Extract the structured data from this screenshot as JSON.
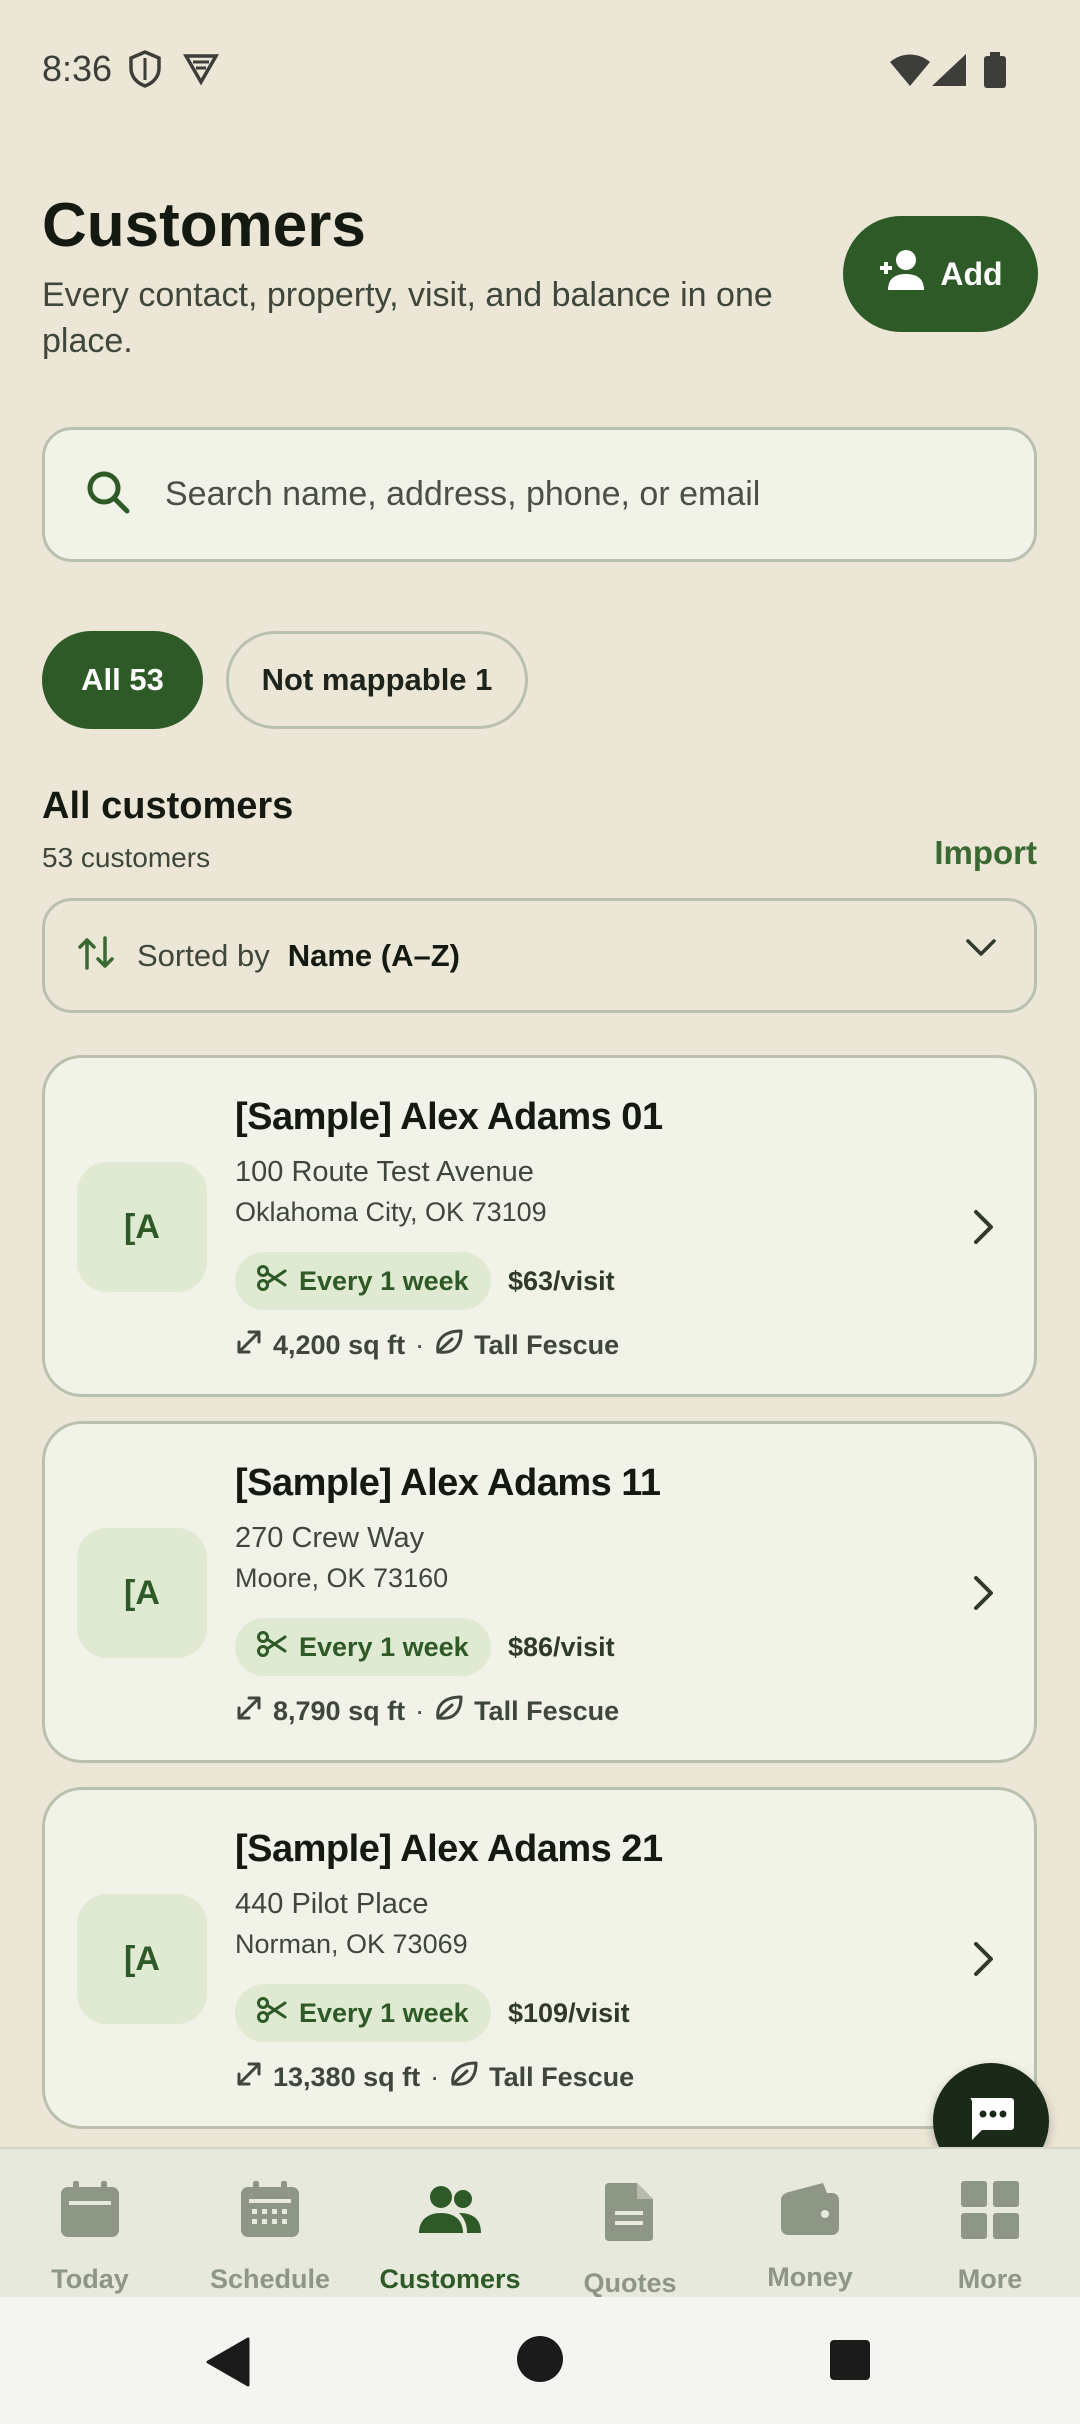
{
  "status_bar": {
    "time": "8:36",
    "icons": [
      "shield-icon",
      "vpn-icon",
      "wifi-icon",
      "signal-icon",
      "battery-icon"
    ]
  },
  "header": {
    "title": "Customers",
    "subtitle": "Every contact, property, visit, and balance in one place.",
    "add_label": "Add"
  },
  "search": {
    "placeholder": "Search name, address, phone, or email",
    "value": ""
  },
  "filters": {
    "all_label": "All 53",
    "not_mappable_label": "Not mappable 1",
    "selected": "All 53"
  },
  "section": {
    "title": "All customers",
    "count": "53 customers",
    "import_label": "Import"
  },
  "sort": {
    "prefix": "Sorted by",
    "value": "Name (A–Z)"
  },
  "customers": [
    {
      "initials": "[A",
      "name": "[Sample] Alex Adams 01",
      "street": "100 Route Test Avenue",
      "city": "Oklahoma City, OK 73109",
      "frequency": "Every 1 week",
      "price": "$63/visit",
      "area": "4,200 sq ft",
      "separator": "·",
      "grass": "Tall Fescue"
    },
    {
      "initials": "[A",
      "name": "[Sample] Alex Adams 11",
      "street": "270 Crew Way",
      "city": "Moore, OK 73160",
      "frequency": "Every 1 week",
      "price": "$86/visit",
      "area": "8,790 sq ft",
      "separator": "·",
      "grass": "Tall Fescue"
    },
    {
      "initials": "[A",
      "name": "[Sample] Alex Adams 21",
      "street": "440 Pilot Place",
      "city": "Norman, OK 73069",
      "frequency": "Every 1 week",
      "price": "$109/visit",
      "area": "13,380 sq ft",
      "separator": "·",
      "grass": "Tall Fescue"
    }
  ],
  "bottom_nav": {
    "items": [
      {
        "label": "Today",
        "icon": "today-icon"
      },
      {
        "label": "Schedule",
        "icon": "calendar-icon"
      },
      {
        "label": "Customers",
        "icon": "people-icon"
      },
      {
        "label": "Quotes",
        "icon": "document-icon"
      },
      {
        "label": "Money",
        "icon": "wallet-icon"
      },
      {
        "label": "More",
        "icon": "grid-icon"
      }
    ],
    "active": "Customers"
  },
  "colors": {
    "background": "#ebe6d5",
    "accent": "#2e5a27",
    "card": "#f1f3e8",
    "inactive_nav": "#8e9685"
  }
}
